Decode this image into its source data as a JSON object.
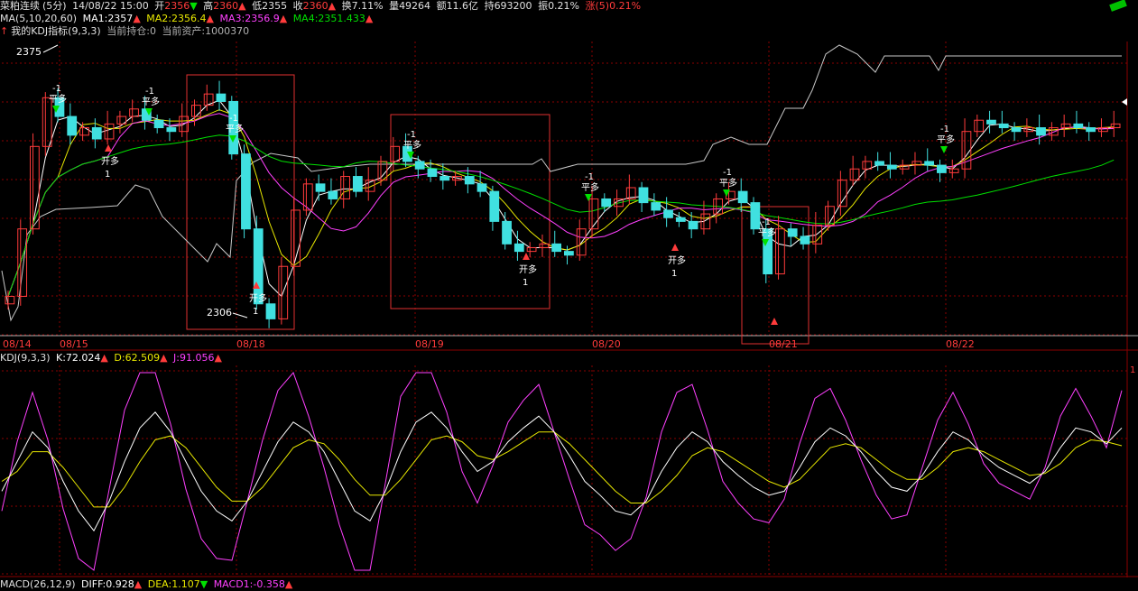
{
  "header": {
    "name": "菜粕连续",
    "period": "(5分)",
    "datetime": "14/08/22 15:00",
    "open_label": "开",
    "open": "2356",
    "high_label": "高",
    "high": "2360",
    "low_label": "低",
    "low": "2355",
    "close_label": "收",
    "close": "2360",
    "turnover_label": "换",
    "turnover": "7.11%",
    "volume_label": "量",
    "volume": "49264",
    "amount_label": "额",
    "amount": "11.6亿",
    "position_label": "持",
    "position": "693200",
    "amplitude_label": "振",
    "amplitude": "0.21%",
    "change_label": "涨(5)",
    "change": "0.21%"
  },
  "ma_legend": {
    "title": "MA(5,10,20,60)",
    "items": [
      {
        "label": "MA1:",
        "value": "2357",
        "color": "#ffffff",
        "trend": "up"
      },
      {
        "label": "MA2:",
        "value": "2356.4",
        "color": "#e8e800",
        "trend": "up"
      },
      {
        "label": "MA3:",
        "value": "2356.9",
        "color": "#ff40ff",
        "trend": "up"
      },
      {
        "label": "MA4:",
        "value": "2351.433",
        "color": "#00e000",
        "trend": "up"
      }
    ]
  },
  "system_line": {
    "text": "我的KDJ指标(9,3,3)",
    "hold_label": "当前持仓:",
    "hold": "0",
    "asset_label": "当前资产:",
    "asset": "1000370"
  },
  "kdj_legend": {
    "title": "KDJ(9,3,3)",
    "items": [
      {
        "label": "K:",
        "value": "72.024",
        "color": "#ffffff",
        "trend": "up"
      },
      {
        "label": "D:",
        "value": "62.509",
        "color": "#e8e800",
        "trend": "up"
      },
      {
        "label": "J:",
        "value": "91.056",
        "color": "#ff40ff",
        "trend": "up"
      }
    ]
  },
  "macd_legend": {
    "title": "MACD(26,12,9)",
    "items": [
      {
        "label": "DIFF:",
        "value": "0.928",
        "color": "#ffffff",
        "trend": "up"
      },
      {
        "label": "DEA:",
        "value": "1.107",
        "color": "#e8e800",
        "trend": "down"
      },
      {
        "label": "MACD1:",
        "value": "-0.358",
        "color": "#ff40ff",
        "trend": "up"
      }
    ]
  },
  "labels": {
    "high_price": "2375",
    "low_price": "2306",
    "kdj_axis_top": "1"
  },
  "signal_text": {
    "open_long": "开多",
    "close_long": "平多",
    "one": "1",
    "minus_one": "-1"
  },
  "colors": {
    "up": "#ff3b3b",
    "down": "#40e0e0",
    "grid": "#8b0000",
    "ma1": "#ffffff",
    "ma2": "#e8e800",
    "ma3": "#ff40ff",
    "ma4": "#00e000",
    "asset": "#c8c8c8",
    "box": "#e03030"
  },
  "chart_data": {
    "type": "candlestick",
    "dates": [
      "08/14",
      "08/15",
      "08/18",
      "08/19",
      "08/20",
      "08/21",
      "08/22"
    ],
    "price_range": [
      2302,
      2380
    ],
    "price_extremes": {
      "high": 2375,
      "low": 2306
    },
    "close_series": [
      2312,
      2330,
      2352,
      2365,
      2360,
      2355,
      2357,
      2354,
      2358,
      2360,
      2362,
      2359,
      2357,
      2356,
      2360,
      2363,
      2366,
      2364,
      2350,
      2330,
      2310,
      2306,
      2320,
      2335,
      2342,
      2340,
      2338,
      2344,
      2340,
      2343,
      2348,
      2352,
      2348,
      2346,
      2344,
      2343,
      2344,
      2342,
      2340,
      2332,
      2326,
      2324,
      2325,
      2326,
      2324,
      2323,
      2330,
      2338,
      2336,
      2338,
      2341,
      2337,
      2335,
      2333,
      2332,
      2330,
      2334,
      2338,
      2340,
      2337,
      2330,
      2318,
      2330,
      2328,
      2326,
      2331,
      2336,
      2343,
      2346,
      2348,
      2347,
      2346,
      2347,
      2348,
      2347,
      2345,
      2346,
      2356,
      2359,
      2358,
      2357,
      2356,
      2357,
      2355,
      2357,
      2358,
      2357,
      2356,
      2357,
      2358
    ],
    "signals": [
      {
        "date": "08/15",
        "type": "close_long",
        "label": "平多"
      },
      {
        "date": "08/15",
        "type": "open_long",
        "label": "开多"
      },
      {
        "date": "08/15",
        "type": "close_long",
        "label": "平多"
      },
      {
        "date": "08/18",
        "type": "close_long",
        "label": "平多"
      },
      {
        "date": "08/18",
        "type": "open_long",
        "label": "开多"
      },
      {
        "date": "08/19",
        "type": "close_long",
        "label": "平多"
      },
      {
        "date": "08/19",
        "type": "open_long",
        "label": "开多"
      },
      {
        "date": "08/20",
        "type": "close_long",
        "label": "平多"
      },
      {
        "date": "08/20",
        "type": "open_long",
        "label": "开多"
      },
      {
        "date": "08/20",
        "type": "close_long",
        "label": "平多"
      },
      {
        "date": "08/21",
        "type": "close_long",
        "label": "平多"
      },
      {
        "date": "08/22",
        "type": "close_long",
        "label": "平多"
      }
    ],
    "kdj": {
      "range": [
        0,
        100
      ],
      "K": [
        40,
        55,
        70,
        62,
        45,
        30,
        20,
        35,
        55,
        72,
        80,
        70,
        55,
        40,
        30,
        25,
        35,
        50,
        65,
        75,
        70,
        60,
        45,
        30,
        25,
        40,
        60,
        75,
        80,
        72,
        60,
        50,
        55,
        65,
        72,
        78,
        70,
        58,
        45,
        38,
        30,
        28,
        35,
        50,
        62,
        70,
        65,
        55,
        48,
        42,
        38,
        40,
        52,
        65,
        72,
        68,
        60,
        50,
        42,
        40,
        48,
        60,
        70,
        66,
        58,
        52,
        48,
        44,
        50,
        62,
        72,
        70,
        64,
        72
      ],
      "D": [
        45,
        50,
        60,
        60,
        52,
        42,
        32,
        32,
        42,
        55,
        66,
        68,
        62,
        52,
        42,
        35,
        35,
        42,
        52,
        62,
        66,
        64,
        56,
        46,
        38,
        38,
        46,
        56,
        66,
        68,
        65,
        58,
        56,
        60,
        65,
        70,
        70,
        64,
        56,
        48,
        40,
        34,
        34,
        40,
        48,
        58,
        62,
        60,
        55,
        50,
        45,
        42,
        46,
        54,
        62,
        64,
        62,
        56,
        50,
        46,
        46,
        52,
        60,
        62,
        60,
        56,
        52,
        48,
        49,
        54,
        62,
        66,
        65,
        63
      ],
      "J": [
        30,
        65,
        90,
        66,
        31,
        6,
        0,
        41,
        81,
        100,
        100,
        74,
        41,
        16,
        6,
        5,
        35,
        66,
        91,
        100,
        78,
        52,
        23,
        0,
        0,
        44,
        88,
        100,
        100,
        80,
        50,
        34,
        53,
        75,
        86,
        94,
        70,
        46,
        23,
        18,
        10,
        16,
        37,
        70,
        90,
        94,
        71,
        45,
        34,
        26,
        24,
        36,
        64,
        87,
        92,
        76,
        56,
        38,
        26,
        28,
        52,
        76,
        90,
        74,
        54,
        44,
        40,
        36,
        52,
        78,
        92,
        78,
        62,
        91
      ]
    }
  }
}
